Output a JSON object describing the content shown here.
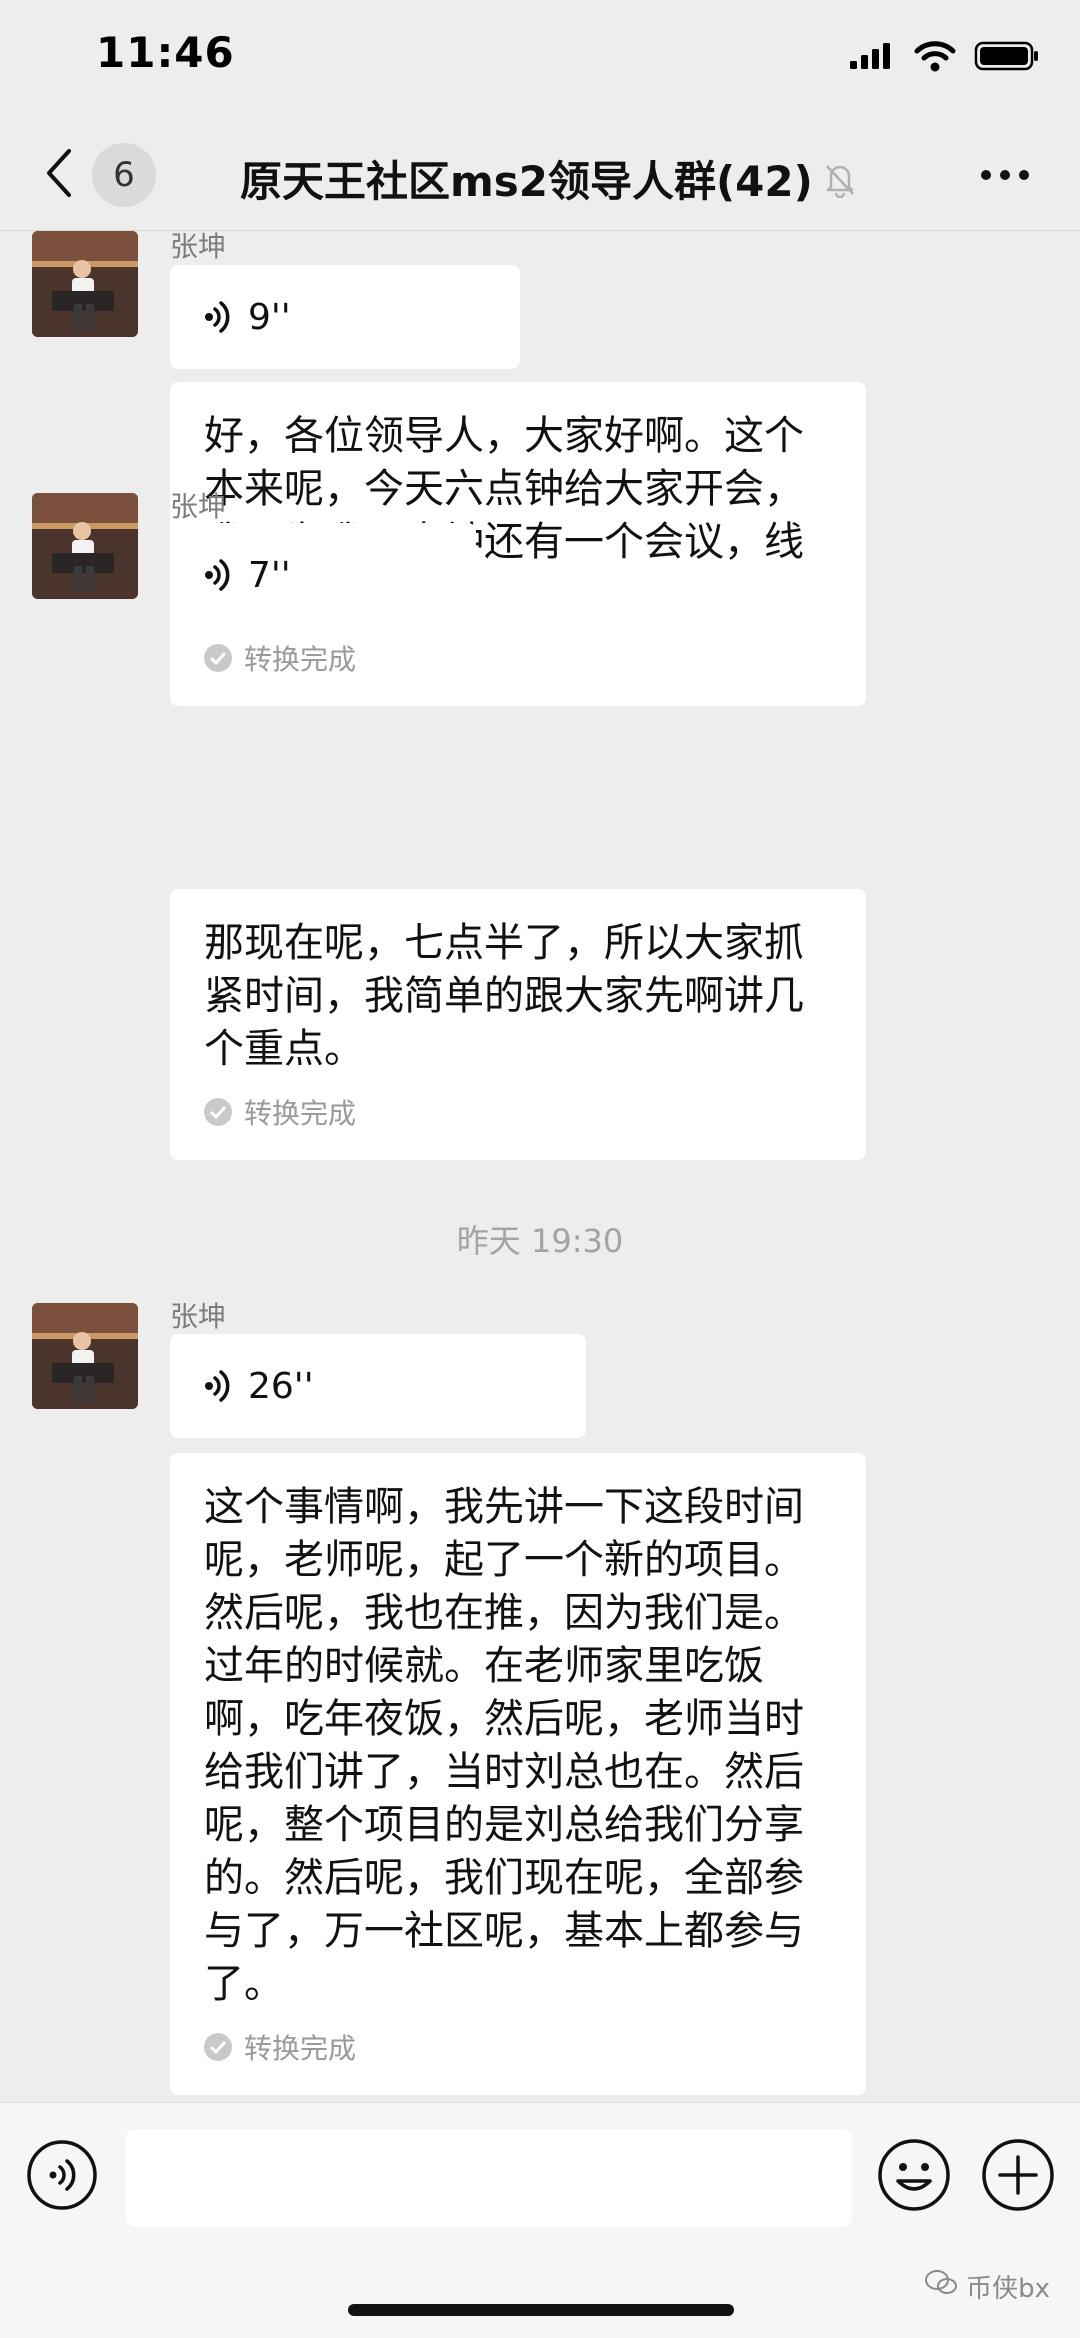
{
  "status_bar": {
    "time": "11:46"
  },
  "header": {
    "back_count": "6",
    "title": "原天王社区ms2领导人群(42)"
  },
  "messages": [
    {
      "sender": "张坤",
      "voice_duration": "9''",
      "transcript": "好，各位领导人，大家好啊。这个本来呢，今天六点钟给大家开会，我因为我八点钟还有一个会议，线上的课程要讲。",
      "status": "转换完成"
    },
    {
      "sender": "张坤",
      "voice_duration": "7''",
      "transcript": "那现在呢，七点半了，所以大家抓紧时间，我简单的跟大家先啊讲几个重点。",
      "status": "转换完成"
    },
    {
      "sender": "张坤",
      "voice_duration": "26''",
      "transcript": "这个事情啊，我先讲一下这段时间呢，老师呢，起了一个新的项目。然后呢，我也在推，因为我们是。过年的时候就。在老师家里吃饭啊，吃年夜饭，然后呢，老师当时给我们讲了，当时刘总也在。然后呢，整个项目的是刘总给我们分享的。然后呢，我们现在呢，全部参与了，万一社区呢，基本上都参与了。",
      "status": "转换完成"
    }
  ],
  "timestamp": "昨天 19:30",
  "watermark": "币侠bx"
}
